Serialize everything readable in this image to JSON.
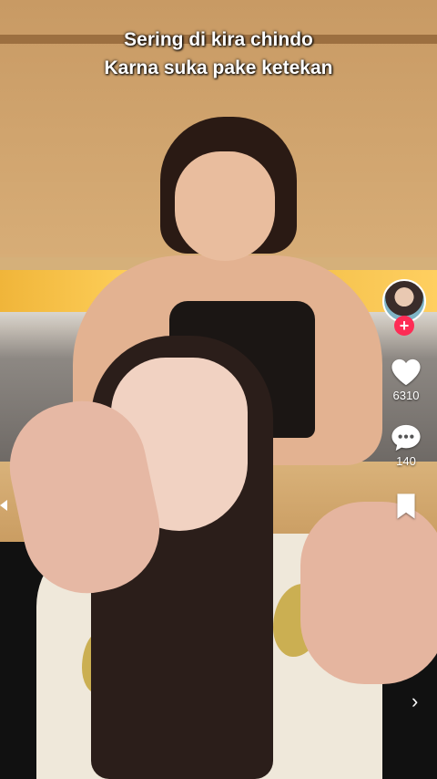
{
  "video": {
    "caption_line1": "Sering di kira chindo",
    "caption_line2": "Karna suka pake ketekan"
  },
  "actions": {
    "follow_symbol": "+",
    "like_count": "6310",
    "comment_count": "140",
    "like_icon": "heart-icon",
    "comment_icon": "comment-bubble-icon",
    "bookmark_icon": "bookmark-icon",
    "next_icon": "chevron-right-icon"
  },
  "colors": {
    "follow_badge": "#fe2c55",
    "icon": "#ffffff"
  }
}
